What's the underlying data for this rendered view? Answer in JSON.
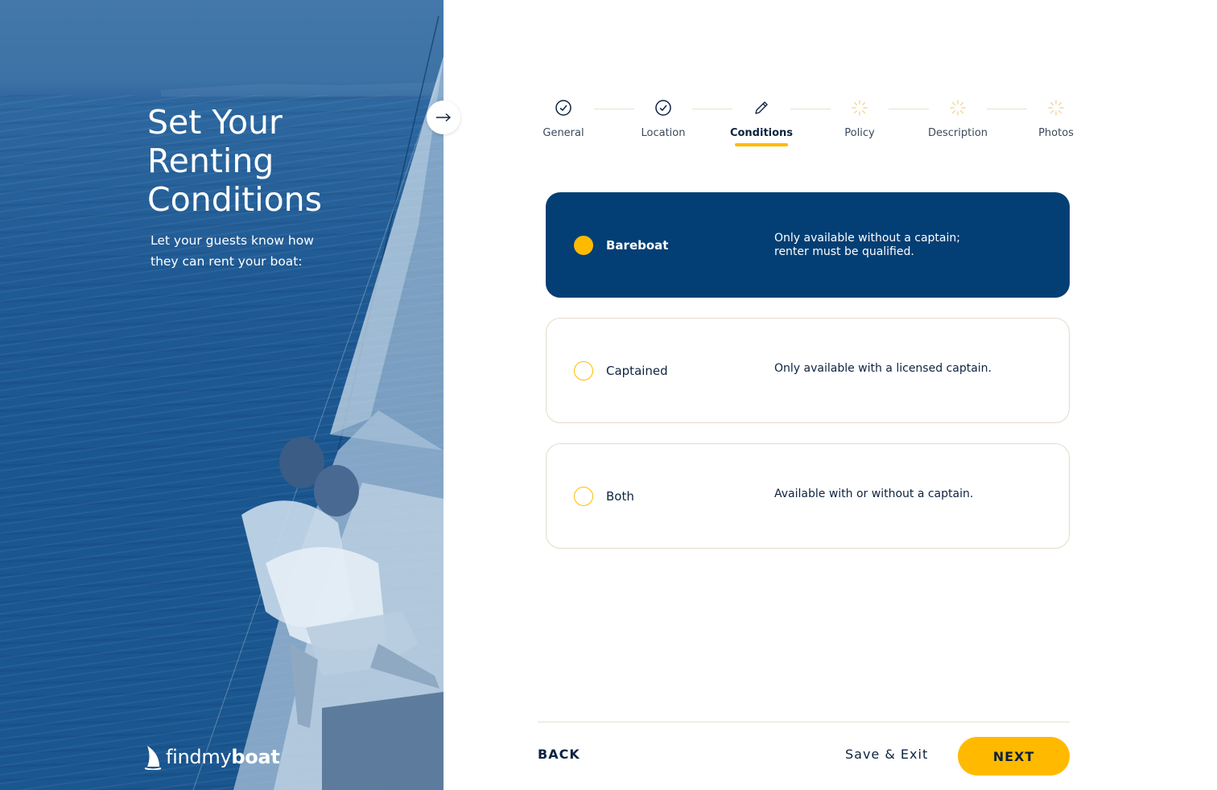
{
  "hero": {
    "title_lines": [
      "Set Your",
      "Renting",
      "Conditions"
    ],
    "subtitle": "Let your guests know how they can rent your boat:",
    "logo": {
      "part1": "find",
      "part2": "my",
      "part3": "boat"
    }
  },
  "stepper": {
    "steps": [
      {
        "label": "General",
        "state": "complete",
        "icon": "check-circle-icon"
      },
      {
        "label": "Location",
        "state": "complete",
        "icon": "check-circle-icon"
      },
      {
        "label": "Conditions",
        "state": "active",
        "icon": "pencil-icon"
      },
      {
        "label": "Policy",
        "state": "pending",
        "icon": "loader-icon"
      },
      {
        "label": "Description",
        "state": "pending",
        "icon": "loader-icon"
      },
      {
        "label": "Photos",
        "state": "pending",
        "icon": "loader-icon"
      }
    ]
  },
  "options": [
    {
      "name": "Bareboat",
      "desc_lines": [
        "Only available without a captain;",
        "renter must be qualified."
      ],
      "selected": true
    },
    {
      "name": "Captained",
      "desc_lines": [
        "Only available with a licensed captain."
      ],
      "selected": false
    },
    {
      "name": "Both",
      "desc_lines": [
        "Available with or without a captain."
      ],
      "selected": false
    }
  ],
  "footer": {
    "back_label": "BACK",
    "save_label": "Save & Exit",
    "next_label": "NEXT"
  },
  "colors": {
    "accent": "#ffba00",
    "navy": "#033f74",
    "text": "#0d2340",
    "border": "#e4dcc8"
  }
}
